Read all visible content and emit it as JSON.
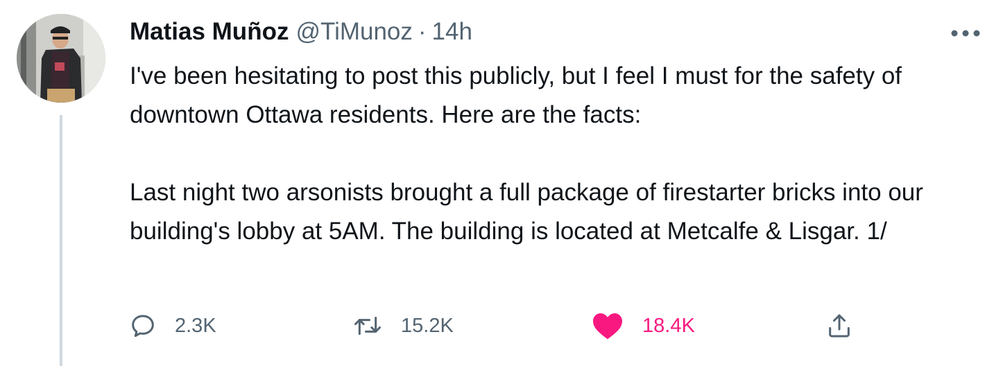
{
  "tweet": {
    "author_name": "Matias Muñoz",
    "author_handle": "@TiMunoz",
    "separator": "·",
    "timestamp": "14h",
    "text": "I've been hesitating to post this publicly, but I feel I must for the safety of downtown Ottawa residents. Here are the facts:\n\nLast night two arsonists brought a full package of firestarter bricks into our building's lobby at 5AM. The building is located at Metcalfe & Lisgar. 1/"
  },
  "actions": {
    "reply_count": "2.3K",
    "retweet_count": "15.2K",
    "like_count": "18.4K",
    "liked": true
  },
  "icons": {
    "more": "more-horizontal-icon",
    "reply": "speech-bubble-icon",
    "retweet": "retweet-arrows-icon",
    "like": "heart-filled-icon",
    "share": "share-upload-icon"
  },
  "colors": {
    "text_primary": "#0f1419",
    "text_secondary": "#536471",
    "like_pink": "#f91880",
    "thread_line": "#cfd9de"
  }
}
